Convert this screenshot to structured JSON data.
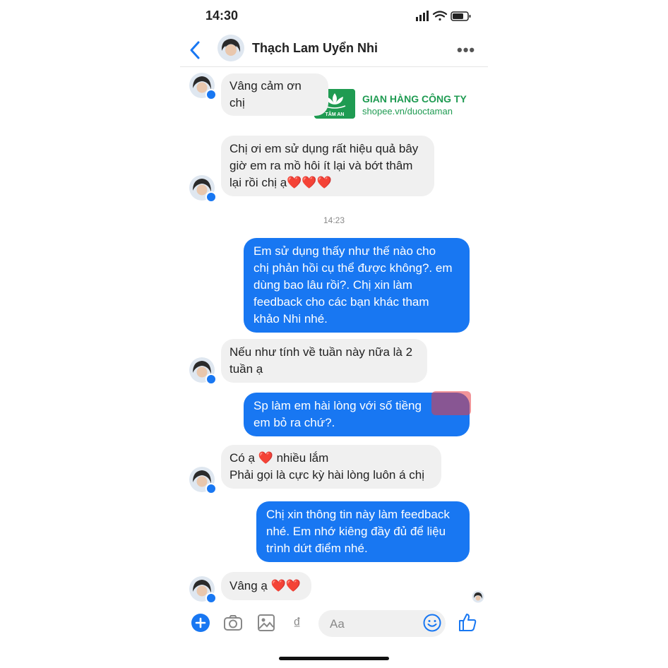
{
  "status_bar": {
    "time": "14:30"
  },
  "header": {
    "contact_name": "Thạch Lam Uyển Nhi",
    "more": "•••"
  },
  "watermark": {
    "logo_text": "TÂM AN",
    "title": "GIAN HÀNG CÔNG TY",
    "url": "shopee.vn/duoctaman"
  },
  "messages": [
    {
      "side": "in",
      "text": "Vâng cảm ơn chị"
    },
    {
      "side": "in",
      "line1": "Chị ơi em sử dụng rất hiệu quả bây",
      "line2": "giờ em ra mồ hôi ít lại và bớt thâm",
      "line3": "lại rồi chị ạ",
      "emoji": "❤️❤️❤️"
    },
    {
      "side": "time",
      "text": "14:23"
    },
    {
      "side": "out",
      "line1": "Em sử dụng thấy như thế nào cho",
      "line2": "chị phản hồi cụ thể được không?. em",
      "line3": "dùng bao lâu rồi?. Chị xin làm",
      "line4": "feedback cho các bạn khác tham",
      "line5": "khảo Nhi nhé."
    },
    {
      "side": "in",
      "line1": "Nếu như tính về tuần này nữa là 2",
      "line2": "tuần ạ"
    },
    {
      "side": "out",
      "line1": "Sp làm em hài lòng với số tiềng",
      "line2": "em bỏ ra chứ?."
    },
    {
      "side": "in",
      "line1a": "Có ạ",
      "emoji": "❤️",
      "line1b": "nhiều lắm",
      "line2": "Phải gọi là cực kỳ hài lòng luôn á chị"
    },
    {
      "side": "out",
      "line1": "Chị xin thông tin này làm feedback",
      "line2": "nhé. Em nhớ kiêng đầy đủ để liệu",
      "line3": "trình dứt điểm nhé."
    },
    {
      "side": "in",
      "text": "Vâng ạ",
      "emoji": "❤️❤️"
    }
  ],
  "composer": {
    "placeholder": "Aa",
    "dong_symbol": "₫"
  },
  "colors": {
    "accent": "#1877f2",
    "incoming_bubble": "#f0f0f0",
    "watermark_green": "#1f9b52"
  }
}
